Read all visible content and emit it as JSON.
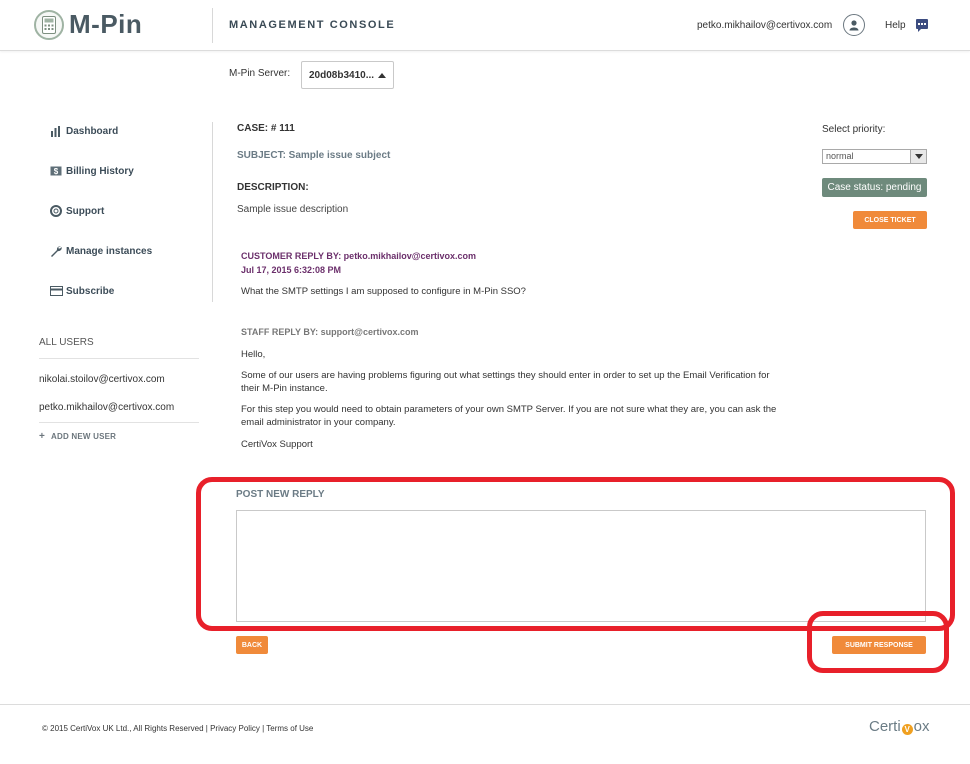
{
  "header": {
    "logo_text": "M-Pin",
    "console_title": "MANAGEMENT CONSOLE",
    "user_email": "petko.mikhailov@certivox.com",
    "help_label": "Help"
  },
  "server": {
    "label": "M-Pin Server:",
    "selected": "20d08b3410..."
  },
  "sidebar": {
    "items": [
      {
        "label": "Dashboard",
        "icon": "bar-chart-icon"
      },
      {
        "label": "Billing History",
        "icon": "money-icon"
      },
      {
        "label": "Support",
        "icon": "lifebuoy-icon"
      },
      {
        "label": "Manage instances",
        "icon": "wrench-icon"
      },
      {
        "label": "Subscribe",
        "icon": "credit-card-icon"
      }
    ],
    "all_users_label": "ALL USERS",
    "users": [
      "nikolai.stoilov@certivox.com",
      "petko.mikhailov@certivox.com"
    ],
    "add_user_label": "ADD NEW USER"
  },
  "case": {
    "id_label": "CASE: # 111",
    "subject": "SUBJECT: Sample issue subject",
    "description_label": "DESCRIPTION:",
    "description": "Sample issue description",
    "priority_label": "Select priority:",
    "priority_value": "normal",
    "status": "Case status: pending",
    "close_label": "CLOSE TICKET"
  },
  "thread": {
    "customer_by": "CUSTOMER REPLY BY: petko.mikhailov@certivox.com",
    "customer_date": "Jul 17, 2015 6:32:08 PM",
    "customer_message": "What the SMTP settings I am supposed to configure in M-Pin SSO?",
    "staff_by": "STAFF REPLY BY: support@certivox.com",
    "staff_p1": "Hello,",
    "staff_p2": "Some of our users are having problems figuring out what settings they should enter in order to set up the Email Verification for their M-Pin instance.",
    "staff_p3": "For this step you would need to obtain parameters of your own SMTP Server. If you are not sure what they are, you can ask the email administrator in your company.",
    "staff_p4": "CertiVox Support"
  },
  "reply": {
    "label": "POST NEW REPLY",
    "value": "",
    "back_label": "BACK",
    "submit_label": "SUBMIT RESPONSE"
  },
  "footer": {
    "copyright": "© 2015 CertiVox UK Ltd., All Rights Reserved | ",
    "privacy": "Privacy Policy",
    "separator": " | ",
    "terms": "Terms of Use",
    "brand_prefix": "Certi",
    "brand_suffix": "ox"
  },
  "colors": {
    "accent_orange": "#f08a3a",
    "status_green": "#6e8a7c",
    "customer_purple": "#6b2f6b",
    "annotation_red": "#e8202a"
  }
}
